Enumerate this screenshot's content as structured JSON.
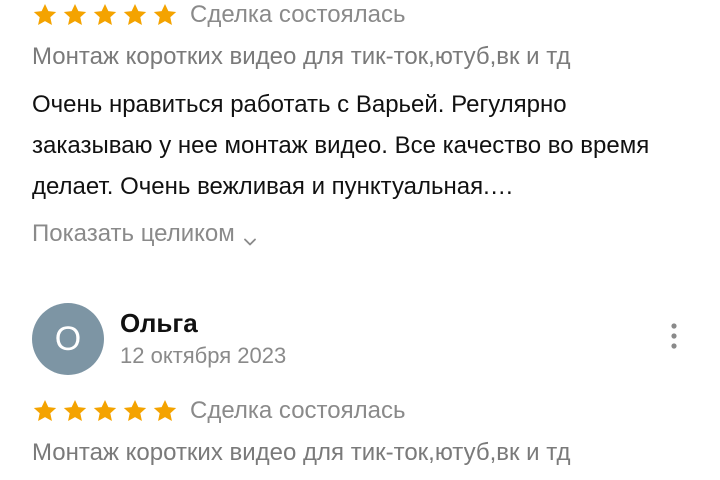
{
  "colors": {
    "star": "#f4a300",
    "avatar_bg": "#7d95a4",
    "muted_text": "#8a8a8a"
  },
  "reviews": [
    {
      "rating": 5,
      "deal_status": "Сделка состоялась",
      "service_title": "Монтаж коротких видео для тик-ток,ютуб,вк и тд",
      "text": "Очень нравиться работать с Варьей. Регулярно заказываю у нее монтаж видео. Все качество во время делает. Очень вежливая и пунктуальная.…",
      "expand_label": "Показать целиком",
      "expand_icon": "chevron-down-icon"
    },
    {
      "author": {
        "initial": "О",
        "name": "Ольга"
      },
      "date": "12 октября 2023",
      "more_icon": "more-vertical-icon",
      "rating": 5,
      "deal_status": "Сделка состоялась",
      "service_title": "Монтаж коротких видео для тик-ток,ютуб,вк и тд"
    }
  ]
}
